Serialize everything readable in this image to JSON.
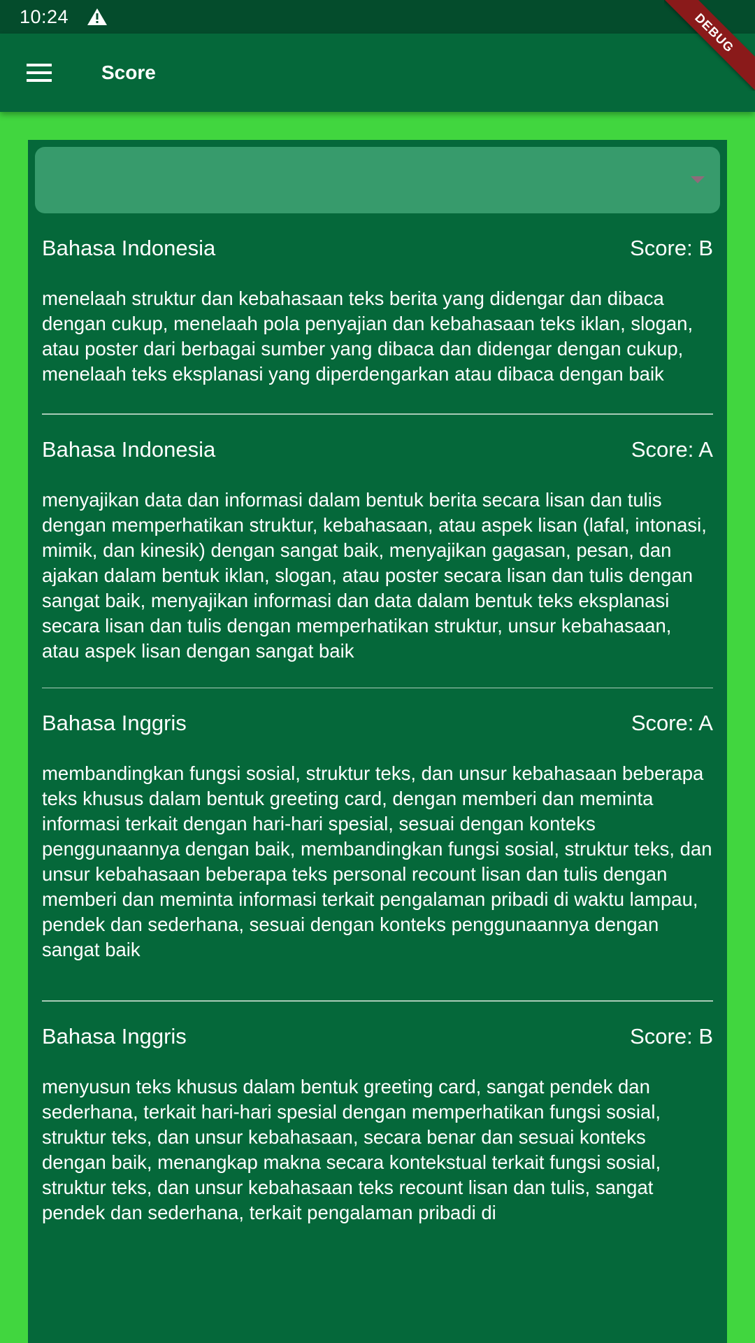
{
  "status_bar": {
    "time": "10:24",
    "warning_icon": "warning-triangle-icon"
  },
  "debug_banner": {
    "label": "DEBUG"
  },
  "app_bar": {
    "menu_icon": "hamburger-menu-icon",
    "title": "Score"
  },
  "dropdown": {
    "selected": "",
    "icon": "dropdown-caret-icon"
  },
  "items": [
    {
      "subject": "Bahasa Indonesia",
      "score": "Score: B",
      "description": "menelaah struktur dan kebahasaan teks berita yang didengar dan dibaca dengan cukup, menelaah pola penyajian dan kebahasaan teks iklan, slogan, atau poster dari berbagai sumber yang dibaca dan didengar dengan cukup, menelaah teks eksplanasi yang diperdengarkan atau dibaca dengan baik"
    },
    {
      "subject": "Bahasa Indonesia",
      "score": "Score: A",
      "description": "menyajikan data dan informasi dalam bentuk berita secara lisan dan tulis dengan memperhatikan struktur, kebahasaan, atau aspek lisan (lafal, intonasi, mimik, dan kinesik) dengan sangat baik, menyajikan gagasan, pesan, dan ajakan dalam bentuk iklan, slogan, atau poster secara lisan dan tulis dengan sangat baik, menyajikan informasi dan data dalam bentuk teks eksplanasi secara lisan dan tulis dengan memperhatikan struktur, unsur kebahasaan, atau aspek lisan dengan sangat baik"
    },
    {
      "subject": "Bahasa Inggris",
      "score": "Score: A",
      "description": "membandingkan fungsi sosial, struktur teks, dan unsur kebahasaan beberapa teks khusus dalam bentuk greeting card, dengan memberi dan meminta informasi terkait dengan hari-hari spesial, sesuai dengan konteks penggunaannya dengan baik, membandingkan fungsi sosial, struktur teks, dan unsur kebahasaan beberapa teks personal recount lisan dan tulis dengan memberi dan meminta informasi terkait pengalaman pribadi di waktu lampau, pendek dan sederhana, sesuai dengan konteks penggunaannya dengan sangat baik"
    },
    {
      "subject": "Bahasa Inggris",
      "score": "Score: B",
      "description": "menyusun teks khusus dalam bentuk greeting card, sangat pendek dan sederhana, terkait hari-hari spesial dengan memperhatikan fungsi sosial, struktur teks, dan unsur kebahasaan, secara benar dan sesuai konteks dengan baik, menangkap makna secara kontekstual terkait fungsi sosial, struktur teks, dan unsur kebahasaan teks recount lisan dan tulis, sangat pendek dan sederhana, terkait pengalaman pribadi di"
    }
  ]
}
